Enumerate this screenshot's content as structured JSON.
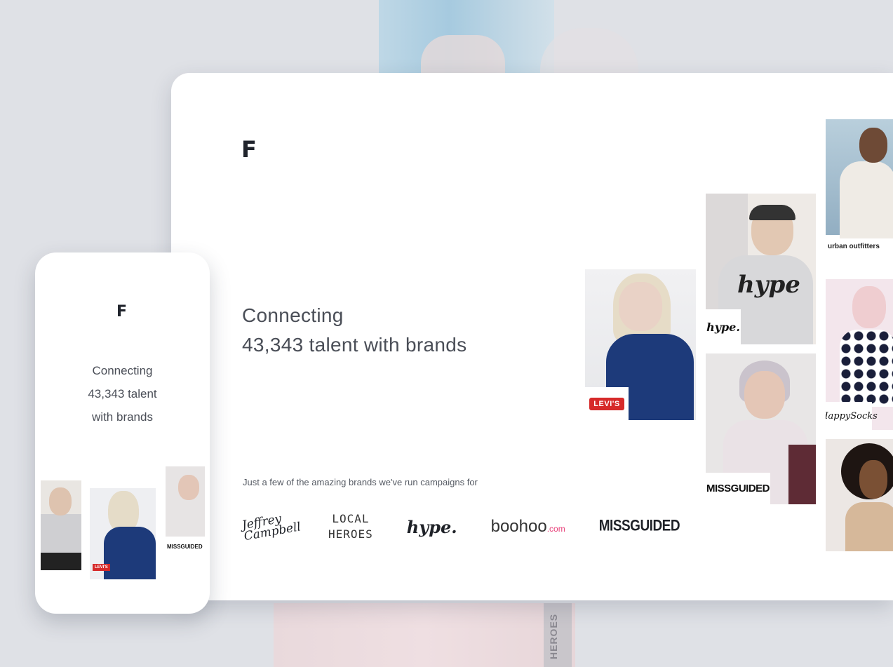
{
  "desktop": {
    "logo": "F",
    "hero_line1": "Connecting",
    "hero_line2": "43,343 talent with brands",
    "brands_caption": "Just a few of the amazing brands we've run campaigns for",
    "brand_logos": {
      "jeffrey": "Jeffrey Campbell",
      "local_line1": "LOCAL",
      "local_line2": "HEROES",
      "hype": "hype.",
      "boohoo": "boohoo",
      "boohoo_suffix": ".com",
      "missguided": "MISSGUIDED"
    },
    "tiles": {
      "levis_tag": "LEVI'S",
      "hype_script": "hype",
      "hype_tag": "hype.",
      "missguided_tag": "MISSGUIDED",
      "urban_label": "urban outfitters",
      "happy_tag": "HappySocks"
    }
  },
  "mobile": {
    "logo": "F",
    "hero_line1": "Connecting",
    "hero_line2": "43,343 talent",
    "hero_line3": "with brands",
    "levis_tag": "LEVI'S",
    "missguided_label": "MISSGUIDED"
  },
  "background": {
    "stripe_text": "HEROES"
  },
  "colors": {
    "background": "#dfe1e6",
    "card": "#ffffff",
    "text": "#4a4e57",
    "levis_red": "#d62a2a",
    "denim": "#1d3a7a",
    "boohoo_pink": "#e8417a"
  }
}
